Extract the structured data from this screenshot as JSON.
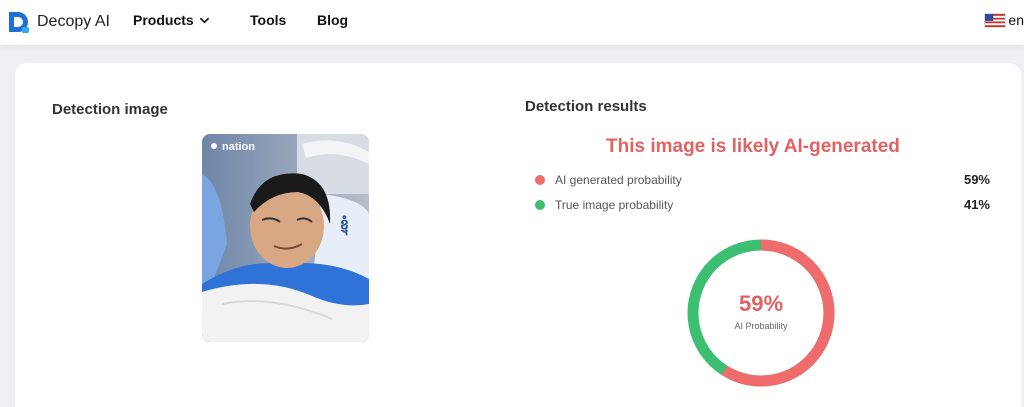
{
  "nav": {
    "brand": "Decopy AI",
    "items": [
      {
        "label": "Products",
        "has_dropdown": true
      },
      {
        "label": "Tools"
      },
      {
        "label": "Blog"
      }
    ],
    "language": "en"
  },
  "detection": {
    "image_title": "Detection image",
    "image_watermark": "nation",
    "results_title": "Detection results",
    "verdict": "This image is likely AI-generated",
    "ai_label": "AI generated probability",
    "ai_value": "59%",
    "true_label": "True image probability",
    "true_value": "41%",
    "gauge_value": "59%",
    "gauge_caption": "AI Probability",
    "ai_fraction": 0.59,
    "true_fraction": 0.41
  },
  "colors": {
    "ai": "#f06c6c",
    "true": "#3cbf71",
    "verdict": "#e26262"
  }
}
